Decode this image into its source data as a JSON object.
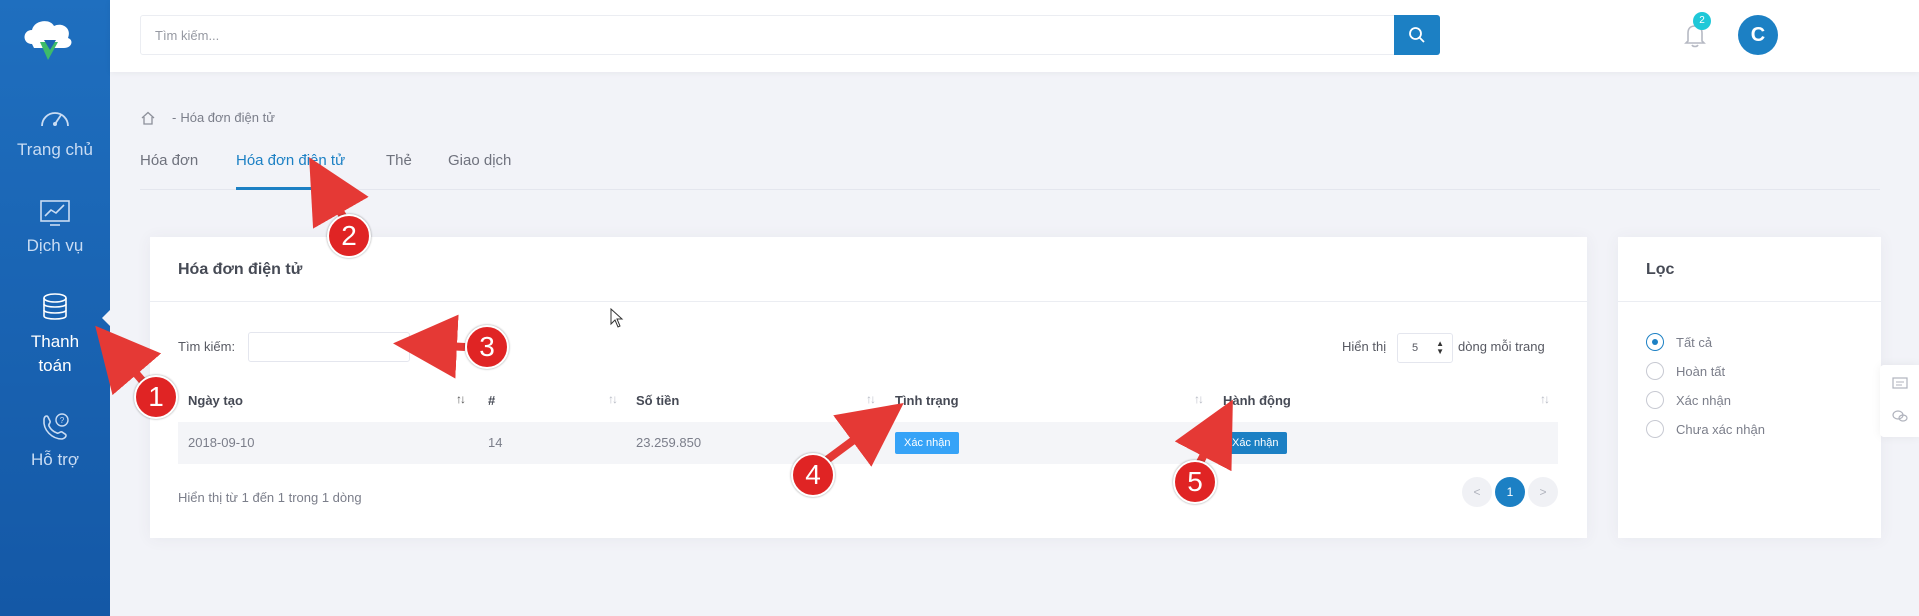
{
  "sidebar": {
    "items": [
      {
        "label": "Trang chủ",
        "icon": "speedometer-icon"
      },
      {
        "label": "Dịch vụ",
        "icon": "chart-icon"
      },
      {
        "label": "Thanh toán",
        "icon": "coins-icon"
      },
      {
        "label": "Hỗ trợ",
        "icon": "support-phone-icon"
      }
    ]
  },
  "header": {
    "search_placeholder": "Tìm kiếm...",
    "notification_count": "2",
    "avatar_letter": "C"
  },
  "breadcrumb": {
    "current": "Hóa đơn điện tử",
    "separator": "-"
  },
  "tabs": [
    {
      "label": "Hóa đơn"
    },
    {
      "label": "Hóa đơn điện tử"
    },
    {
      "label": "Thẻ"
    },
    {
      "label": "Giao dịch"
    }
  ],
  "main_card": {
    "title": "Hóa đơn điện tử",
    "search_label": "Tìm kiếm:",
    "show_label": "Hiển thị",
    "per_page_value": "5",
    "per_page_suffix": "dòng mỗi trang",
    "columns": [
      "Ngày tạo",
      "#",
      "Số tiền",
      "Tình trạng",
      "Hành động"
    ],
    "rows": [
      {
        "date": "2018-09-10",
        "id": "14",
        "amount": "23.259.850",
        "status": "Xác nhận",
        "action": "Xác nhận"
      }
    ],
    "footer_info": "Hiển thị từ 1 đến 1 trong 1 dòng",
    "pagination": {
      "prev": "<",
      "current": "1",
      "next": ">"
    }
  },
  "filter_card": {
    "title": "Lọc",
    "options": [
      {
        "label": "Tất cả",
        "checked": true
      },
      {
        "label": "Hoàn tất",
        "checked": false
      },
      {
        "label": "Xác nhận",
        "checked": false
      },
      {
        "label": "Chưa xác nhận",
        "checked": false
      }
    ]
  },
  "annotations": [
    "1",
    "2",
    "3",
    "4",
    "5"
  ],
  "colors": {
    "sidebar": "#1c64b4",
    "primary": "#1c80c4",
    "badge_status": "#36a3f7",
    "notification_badge": "#1fc8d8",
    "annotation": "#e02424"
  }
}
